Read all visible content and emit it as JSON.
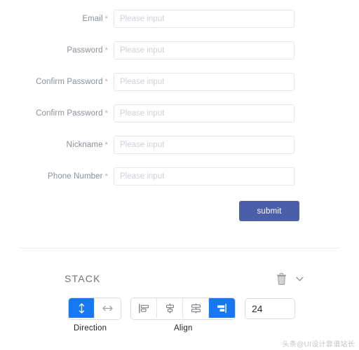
{
  "form": {
    "placeholder": "Please input",
    "required_mark": "*",
    "fields": [
      {
        "label": "Email",
        "value": ""
      },
      {
        "label": "Password",
        "value": ""
      },
      {
        "label": "Confirm Password",
        "value": ""
      },
      {
        "label": "Confirm Password",
        "value": ""
      },
      {
        "label": "Nickname",
        "value": ""
      },
      {
        "label": "Phone Number",
        "value": ""
      }
    ],
    "submit_label": "submit",
    "submit_color": "#4a5eaa"
  },
  "stack": {
    "title": "STACK",
    "delete_icon": "trash-icon",
    "collapse_icon": "chevron-down-icon",
    "direction": {
      "caption": "Direction",
      "options": [
        {
          "icon": "arrow-vertical-icon",
          "active": true
        },
        {
          "icon": "arrow-horizontal-icon",
          "active": false
        }
      ]
    },
    "align": {
      "caption": "Align",
      "options": [
        {
          "icon": "align-left-icon",
          "active": false
        },
        {
          "icon": "align-center-vertical-icon",
          "active": false
        },
        {
          "icon": "distribute-vertical-icon",
          "active": false
        },
        {
          "icon": "align-right-icon",
          "active": true
        }
      ]
    },
    "spacing_value": "24",
    "active_color": "#1678f2"
  },
  "watermark": {
    "text": "头条@UI设计靠谱站长"
  }
}
